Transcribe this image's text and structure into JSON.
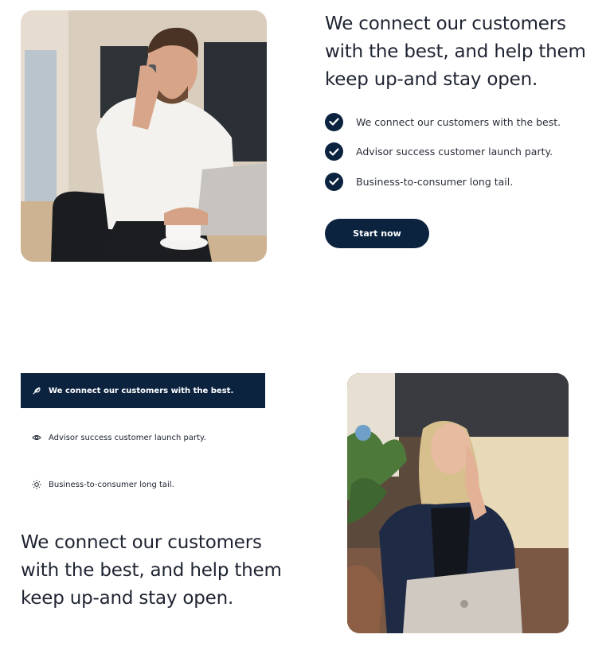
{
  "section1": {
    "headline": "We connect our customers with the best, and help them keep up-and stay open.",
    "checklist": [
      {
        "label": "We connect our customers with the best.",
        "icon": "check-circle-icon"
      },
      {
        "label": "Advisor success customer launch party.",
        "icon": "check-circle-icon"
      },
      {
        "label": "Business-to-consumer long tail.",
        "icon": "check-circle-icon"
      }
    ],
    "cta_label": "Start now"
  },
  "section2": {
    "tabs": [
      {
        "label": "We connect our customers with the best.",
        "icon": "feather-icon",
        "active": true
      },
      {
        "label": "Advisor success customer launch party.",
        "icon": "eye-icon",
        "active": false
      },
      {
        "label": "Business-to-consumer long tail.",
        "icon": "sun-icon",
        "active": false
      }
    ],
    "headline": "We connect our customers with the best, and help them keep up-and stay open."
  },
  "colors": {
    "brand_navy": "#0c2340",
    "text": "#1f2432",
    "background": "#ffffff"
  }
}
